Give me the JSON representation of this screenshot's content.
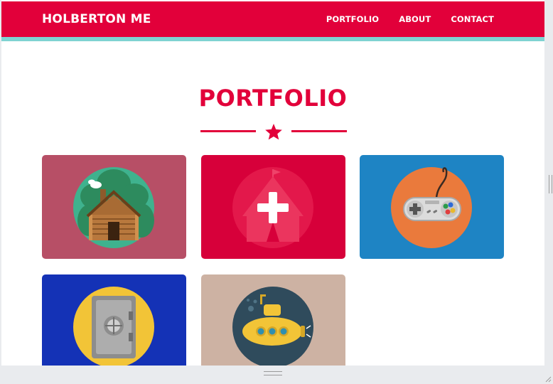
{
  "navbar": {
    "brand": "HOLBERTON ME",
    "links": [
      "PORTFOLIO",
      "ABOUT",
      "CONTACT"
    ]
  },
  "portfolio": {
    "title": "PORTFOLIO",
    "divider_icon": "star-icon",
    "tiles": [
      {
        "icon": "log-cabin-icon",
        "background": "#b74f66",
        "circle": "#3fb28e"
      },
      {
        "icon": "circus-tent-icon",
        "background": "#d7003a",
        "circle": "#e51b4d",
        "overlay_icon": "plus-icon"
      },
      {
        "icon": "game-controller-icon",
        "background": "#1e84c4",
        "circle": "#ea7a3c"
      },
      {
        "icon": "safe-icon",
        "background": "#1432b6",
        "circle": "#f2c437"
      },
      {
        "icon": "submarine-icon",
        "background": "#cdb2a3",
        "circle": "#2f4b5c"
      }
    ]
  },
  "colors": {
    "accent": "#e2003a",
    "navbar_border": "#7fd3d2",
    "page_background": "#ffffff"
  }
}
